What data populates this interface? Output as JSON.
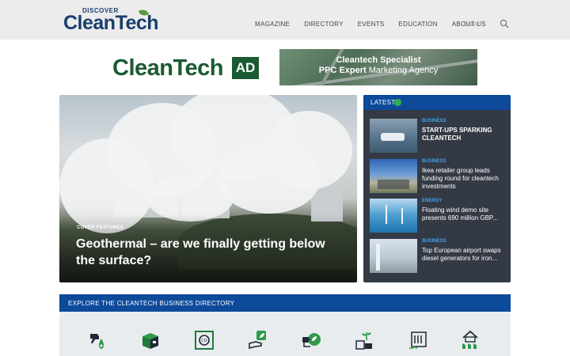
{
  "header": {
    "logo_small": "DISCOVER",
    "logo_main": "CleanTech",
    "nav": [
      "MAGAZINE",
      "DIRECTORY",
      "EVENTS",
      "EDUCATION",
      "ABOUT US"
    ],
    "search_placeholder": "Search",
    "search_icon": "search-icon"
  },
  "ad": {
    "logo_text": "CleanTech",
    "logo_badge": "AD",
    "banner_line1": "Cleantech Specialist",
    "banner_line2_bold": "PPC Expert",
    "banner_line2_rest": " Marketing Agency"
  },
  "hero": {
    "kicker": "COVER FEATURES",
    "title": "Geothermal – are we finally getting below the surface?"
  },
  "latest": {
    "heading": "LATEST",
    "items": [
      {
        "category": "BUSINESS",
        "title": "START-UPS SPARKING CLEANTECH"
      },
      {
        "category": "BUSINESS",
        "title": "Ikea retailer group leads funding round for cleantech investments"
      },
      {
        "category": "ENERGY",
        "title": "Floating wind demo site presents 690 million GBP..."
      },
      {
        "category": "BUSINESS",
        "title": "Top European airport swaps diesel generators for iron..."
      }
    ]
  },
  "directory": {
    "heading": "EXPLORE THE CLEANTECH BUSINESS DIRECTORY",
    "icons": [
      "fuel-nozzle-icon",
      "packaging-box-icon",
      "co2-icon",
      "eco-hand-icon",
      "electric-plug-icon",
      "sprout-battery-icon",
      "energy-storage-icon",
      "green-building-icon"
    ]
  },
  "colors": {
    "brand_blue": "#0d4a9a",
    "brand_green": "#1b5a33",
    "panel_dark": "#343a45",
    "category_blue": "#3fa3e8"
  }
}
